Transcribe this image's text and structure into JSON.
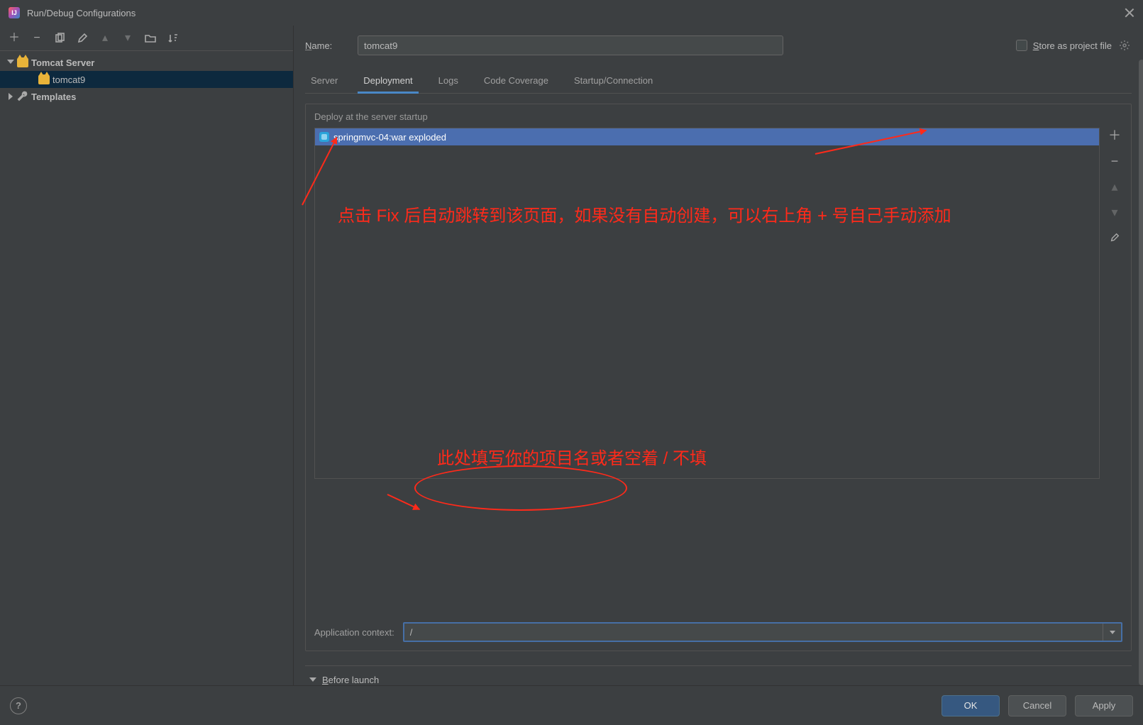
{
  "window": {
    "title": "Run/Debug Configurations"
  },
  "tree": {
    "group_label": "Tomcat Server",
    "config_label": "tomcat9",
    "templates_label": "Templates"
  },
  "name_field": {
    "label_html": "Name:",
    "value": "tomcat9"
  },
  "store_as_file_label": "Store as project file",
  "tabs": {
    "server": "Server",
    "deployment": "Deployment",
    "logs": "Logs",
    "coverage": "Code Coverage",
    "startup": "Startup/Connection"
  },
  "deploy": {
    "section_label": "Deploy at the server startup",
    "artifact": "springmvc-04:war exploded"
  },
  "app_context": {
    "label": "Application context:",
    "value": "/"
  },
  "before_launch_label": "Before launch",
  "buttons": {
    "ok": "OK",
    "cancel": "Cancel",
    "apply": "Apply"
  },
  "annotations": {
    "top": "点击 Fix 后自动跳转到该页面，如果没有自动创建，可以右上角 + 号自己手动添加",
    "bottom": "此处填写你的项目名或者空着 / 不填"
  }
}
